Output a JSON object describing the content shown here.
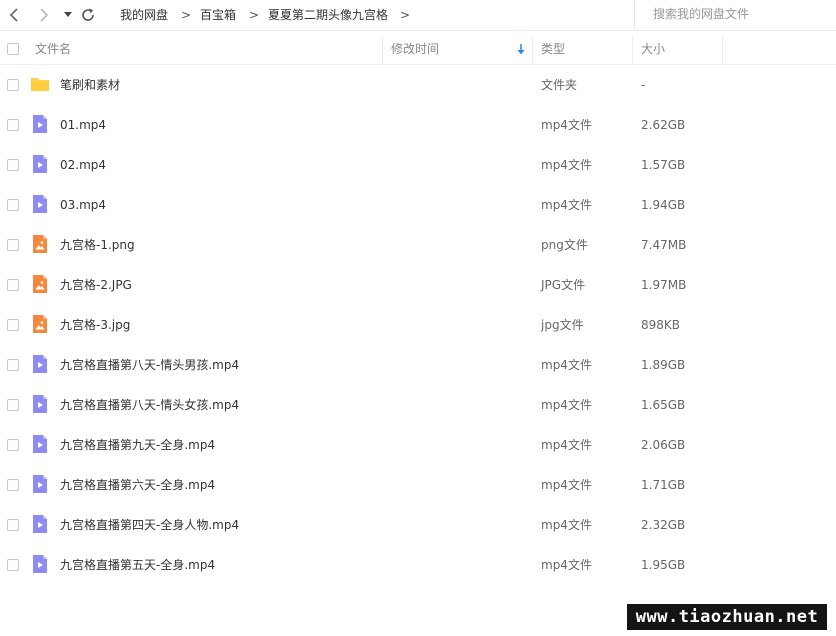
{
  "nav": {
    "back_icon": "chevron-left-icon",
    "forward_icon": "chevron-right-icon",
    "history_icon": "caret-down-icon",
    "refresh_icon": "refresh-icon"
  },
  "breadcrumb": {
    "items": [
      "我的网盘",
      "百宝箱",
      "夏夏第二期头像九宫格"
    ],
    "separator": ">"
  },
  "search": {
    "placeholder": "搜索我的网盘文件"
  },
  "columns": {
    "name": "文件名",
    "modified": "修改时间",
    "type": "类型",
    "size": "大小",
    "sort_icon": "arrow-down-icon"
  },
  "colors": {
    "folder": "#FFD04B",
    "video": "#8E8CF0",
    "image": "#F5883C",
    "sort_arrow": "#2D8CF0"
  },
  "files": [
    {
      "name": "笔刷和素材",
      "type": "文件夹",
      "size": "-",
      "icon": "folder-icon"
    },
    {
      "name": "01.mp4",
      "type": "mp4文件",
      "size": "2.62GB",
      "icon": "video-file-icon"
    },
    {
      "name": "02.mp4",
      "type": "mp4文件",
      "size": "1.57GB",
      "icon": "video-file-icon"
    },
    {
      "name": "03.mp4",
      "type": "mp4文件",
      "size": "1.94GB",
      "icon": "video-file-icon"
    },
    {
      "name": "九宫格-1.png",
      "type": "png文件",
      "size": "7.47MB",
      "icon": "image-file-icon"
    },
    {
      "name": "九宫格-2.JPG",
      "type": "JPG文件",
      "size": "1.97MB",
      "icon": "image-file-icon"
    },
    {
      "name": "九宫格-3.jpg",
      "type": "jpg文件",
      "size": "898KB",
      "icon": "image-file-icon"
    },
    {
      "name": "九宫格直播第八天-情头男孩.mp4",
      "type": "mp4文件",
      "size": "1.89GB",
      "icon": "video-file-icon"
    },
    {
      "name": "九宫格直播第八天-情头女孩.mp4",
      "type": "mp4文件",
      "size": "1.65GB",
      "icon": "video-file-icon"
    },
    {
      "name": "九宫格直播第九天-全身.mp4",
      "type": "mp4文件",
      "size": "2.06GB",
      "icon": "video-file-icon"
    },
    {
      "name": "九宫格直播第六天-全身.mp4",
      "type": "mp4文件",
      "size": "1.71GB",
      "icon": "video-file-icon"
    },
    {
      "name": "九宫格直播第四天-全身人物.mp4",
      "type": "mp4文件",
      "size": "2.32GB",
      "icon": "video-file-icon"
    },
    {
      "name": "九宫格直播第五天-全身.mp4",
      "type": "mp4文件",
      "size": "1.95GB",
      "icon": "video-file-icon"
    }
  ],
  "watermark": "www.tiaozhuan.net"
}
